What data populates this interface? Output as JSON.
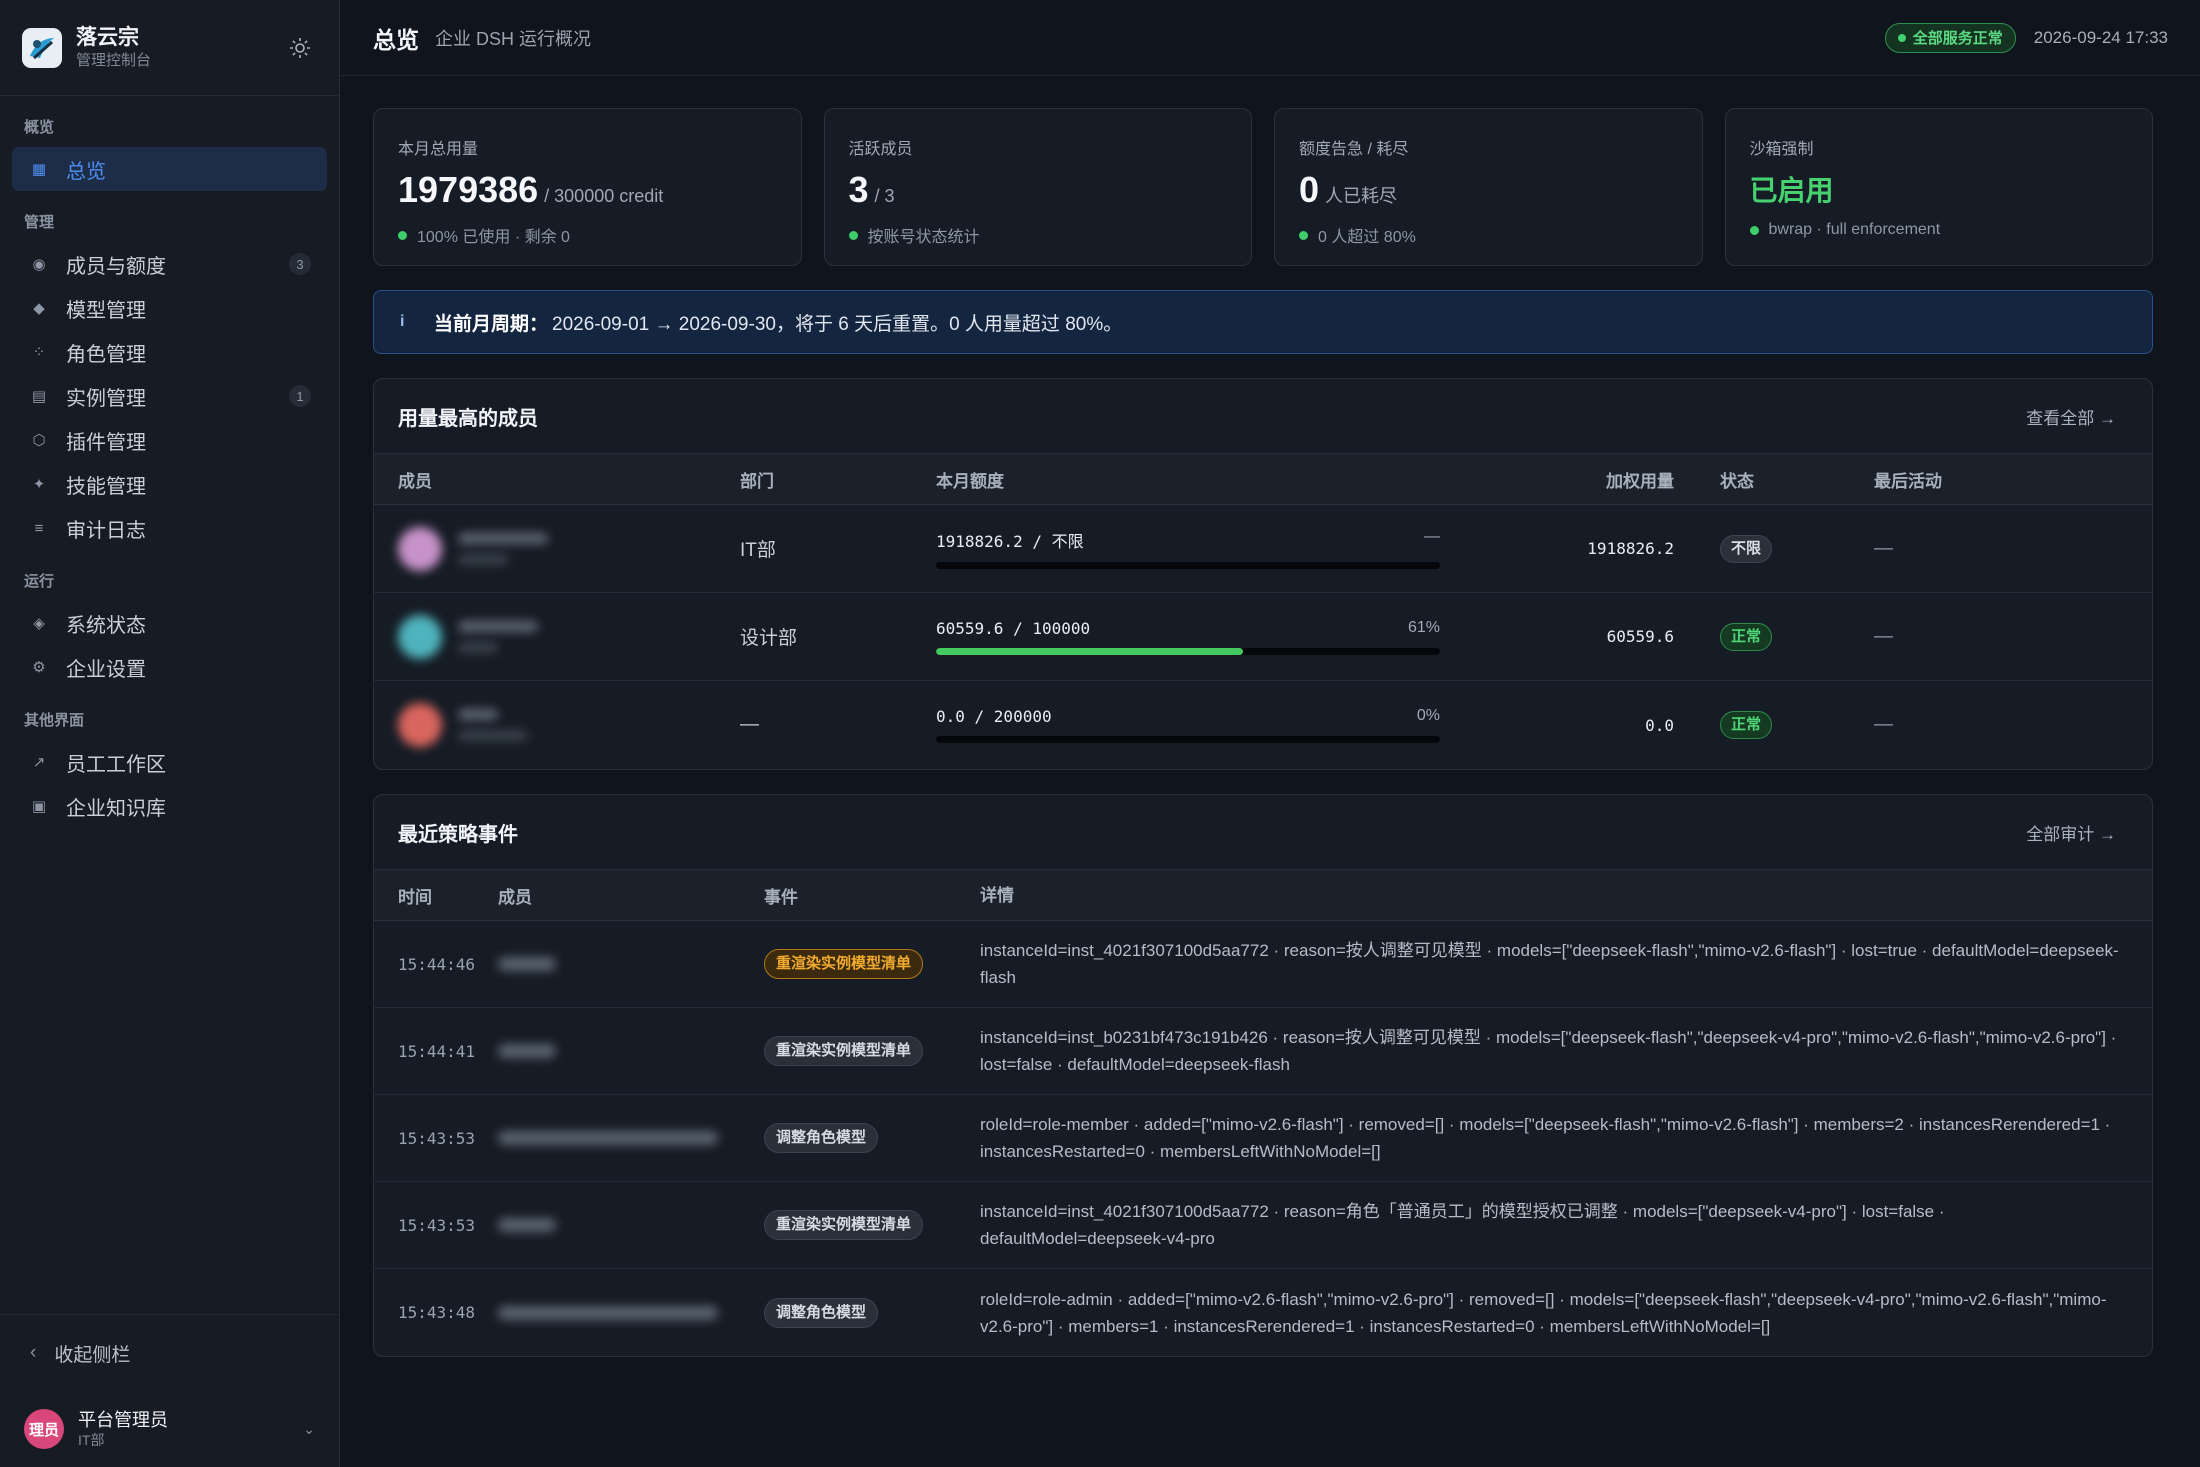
{
  "sidebar": {
    "brand_title": "落云宗",
    "brand_sub": "管理控制台",
    "sections": {
      "overview": "概览",
      "manage": "管理",
      "run": "运行",
      "other": "其他界面"
    },
    "items": {
      "overview": "总览",
      "members": "成员与额度",
      "members_count": "3",
      "models": "模型管理",
      "roles": "角色管理",
      "instances": "实例管理",
      "instances_count": "1",
      "plugins": "插件管理",
      "skills": "技能管理",
      "audit": "审计日志",
      "system": "系统状态",
      "settings": "企业设置",
      "workspace": "员工工作区",
      "knowledge": "企业知识库"
    },
    "collapse": "收起侧栏",
    "user": {
      "avatar": "理员",
      "name": "平台管理员",
      "dept": "IT部"
    }
  },
  "header": {
    "title": "总览",
    "subtitle": "企业 DSH 运行概况",
    "status": "全部服务正常",
    "datetime": "2026-09-24 17:33"
  },
  "stats": [
    {
      "label": "本月总用量",
      "value": "1979386",
      "unit": "/ 300000 credit",
      "foot": "100% 已使用 · 剩余 0"
    },
    {
      "label": "活跃成员",
      "value": "3",
      "unit": "/ 3",
      "foot": "按账号状态统计"
    },
    {
      "label": "额度告急 / 耗尽",
      "value": "0",
      "unit": "人已耗尽",
      "foot": "0 人超过 80%"
    },
    {
      "label": "沙箱强制",
      "value": "已启用",
      "foot": "bwrap · full enforcement"
    }
  ],
  "banner": {
    "bold": "当前月周期：",
    "text": "2026-09-01 → 2026-09-30，将于 6 天后重置。0 人用量超过 80%。"
  },
  "usage": {
    "title": "用量最高的成员",
    "link": "查看全部 →",
    "columns": {
      "member": "成员",
      "dept": "部门",
      "quota": "本月额度",
      "weighted": "加权用量",
      "status": "状态",
      "last": "最后活动"
    },
    "rows": [
      {
        "dept": "IT部",
        "quota": "1918826.2 / 不限",
        "pct": "—",
        "fill": 0,
        "weighted": "1918826.2",
        "status": "不限",
        "last": "—",
        "avatar_color": "#c792c9"
      },
      {
        "dept": "设计部",
        "quota": "60559.6 / 100000",
        "pct": "61%",
        "fill": 0.61,
        "weighted": "60559.6",
        "status": "正常",
        "last": "—",
        "avatar_color": "#4fb3bd"
      },
      {
        "dept": "—",
        "quota": "0.0 / 200000",
        "pct": "0%",
        "fill": 0,
        "weighted": "0.0",
        "status": "正常",
        "last": "—",
        "avatar_color": "#d8655e"
      }
    ]
  },
  "events": {
    "title": "最近策略事件",
    "link": "全部审计 →",
    "columns": {
      "time": "时间",
      "member": "成员",
      "event": "事件",
      "detail": "详情"
    },
    "rows": [
      {
        "time": "15:44:46",
        "event": "重渲染实例模型清单",
        "event_style": "orange",
        "detail": "instanceId=inst_4021f307100d5aa772 · reason=按人调整可见模型 · models=[\"deepseek-flash\",\"mimo-v2.6-flash\"] · lost=true · defaultModel=deepseek-flash"
      },
      {
        "time": "15:44:41",
        "event": "重渲染实例模型清单",
        "event_style": "gray",
        "detail": "instanceId=inst_b0231bf473c191b426 · reason=按人调整可见模型 · models=[\"deepseek-flash\",\"deepseek-v4-pro\",\"mimo-v2.6-flash\",\"mimo-v2.6-pro\"] · lost=false · defaultModel=deepseek-flash"
      },
      {
        "time": "15:43:53",
        "event": "调整角色模型",
        "event_style": "gray",
        "detail": "roleId=role-member · added=[\"mimo-v2.6-flash\"] · removed=[] · models=[\"deepseek-flash\",\"mimo-v2.6-flash\"] · members=2 · instancesRerendered=1 · instancesRestarted=0 · membersLeftWithNoModel=[]"
      },
      {
        "time": "15:43:53",
        "event": "重渲染实例模型清单",
        "event_style": "gray",
        "detail": "instanceId=inst_4021f307100d5aa772 · reason=角色「普通员工」的模型授权已调整 · models=[\"deepseek-v4-pro\"] · lost=false · defaultModel=deepseek-v4-pro"
      },
      {
        "time": "15:43:48",
        "event": "调整角色模型",
        "event_style": "gray",
        "detail": "roleId=role-admin · added=[\"mimo-v2.6-flash\",\"mimo-v2.6-pro\"] · removed=[] · models=[\"deepseek-flash\",\"deepseek-v4-pro\",\"mimo-v2.6-flash\",\"mimo-v2.6-pro\"] · members=1 · instancesRerendered=1 · instancesRestarted=0 · membersLeftWithNoModel=[]"
      }
    ]
  }
}
